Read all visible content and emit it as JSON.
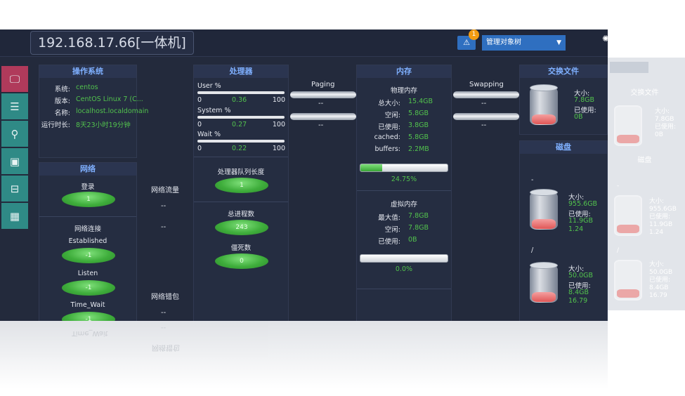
{
  "header": {
    "address": "192.168.17.66[一体机]",
    "alarm_count": "1",
    "alarm_icon": "⚠",
    "tree_select": "管理对象树"
  },
  "nav": [
    "monitor-icon",
    "list-icon",
    "network-icon",
    "storage-icon",
    "disk-icon",
    "table-icon"
  ],
  "os": {
    "title": "操作系统",
    "rows": [
      {
        "label": "系统:",
        "value": "centos"
      },
      {
        "label": "版本:",
        "value": "CentOS Linux 7 (C..."
      },
      {
        "label": "名称:",
        "value": "localhost.localdomain"
      },
      {
        "label": "运行时长:",
        "value": "8天23小时19分钟"
      }
    ]
  },
  "network": {
    "title": "网络",
    "login_label": "登录",
    "login_value": "1",
    "conn_title": "网络连接",
    "established_label": "Established",
    "established_value": "-1",
    "listen_label": "Listen",
    "listen_value": "-1",
    "timewait_label": "Time_Wait",
    "timewait_value": "-1"
  },
  "net_flow": {
    "title": "网络流量",
    "v1": "--",
    "v2": "--",
    "err_title": "网络错包",
    "err_v1": "--",
    "err_v2": "--"
  },
  "cpu": {
    "title": "处理器",
    "user_label": "User %",
    "user_min": "0",
    "user_val": "0.36",
    "user_max": "100",
    "system_label": "System %",
    "system_min": "0",
    "system_val": "0.27",
    "system_max": "100",
    "wait_label": "Wait %",
    "wait_min": "0",
    "wait_val": "0.22",
    "wait_max": "100",
    "queue_label": "处理器队列长度",
    "queue_value": "1",
    "proc_label": "总进程数",
    "proc_value": "243",
    "zombie_label": "僵死数",
    "zombie_value": "0"
  },
  "paging": {
    "label": "Paging",
    "v1": "--",
    "v2": "--"
  },
  "swapping": {
    "label": "Swapping",
    "v1": "--",
    "v2": "--"
  },
  "memory": {
    "title": "内存",
    "phys_title": "物理内存",
    "rows": [
      {
        "label": "总大小:",
        "value": "15.4GB"
      },
      {
        "label": "空闲:",
        "value": "5.8GB"
      },
      {
        "label": "已使用:",
        "value": "3.8GB"
      },
      {
        "label": "cached:",
        "value": "5.8GB"
      },
      {
        "label": "buffers:",
        "value": "2.2MB"
      }
    ],
    "phys_usage": 0.2475,
    "phys_usage_text": "24.75%",
    "virt_title": "虚拟内存",
    "virt_rows": [
      {
        "label": "最大值:",
        "value": "7.8GB"
      },
      {
        "label": "空闲:",
        "value": "7.8GB"
      },
      {
        "label": "已使用:",
        "value": "0B"
      }
    ],
    "virt_usage": 0.0,
    "virt_usage_text": "0.0%"
  },
  "swap_file": {
    "title": "交换文件",
    "size_label": "大小:",
    "size": "7.8GB",
    "used_label": "已使用:",
    "used": "0B"
  },
  "disk": {
    "title": "磁盘",
    "d1": {
      "name": "-",
      "size_label": "大小:",
      "size": "955.6GB",
      "used_label": "已使用:",
      "used": "11.9GB",
      "pct": "1.24"
    },
    "d2": {
      "name": "/",
      "size_label": "大小:",
      "size": "50.0GB",
      "used_label": "已使用:",
      "used": "8.4GB",
      "pct": "16.79"
    }
  },
  "ghost": {
    "swap_title": "交换文件",
    "swap_size_label": "大小:",
    "swap_size": "7.8GB",
    "swap_used_label": "已使用:",
    "swap_used": "0B",
    "disk_title": "磁盘",
    "d1_name": "-",
    "d1_size_label": "大小:",
    "d1_size": "955.6GB",
    "d1_used_label": "已使用:",
    "d1_used": "11.9GB",
    "d1_pct": "1.24",
    "d2_name": "/",
    "d2_size_label": "大小:",
    "d2_size": "50.0GB",
    "d2_used_label": "已使用:",
    "d2_used": "8.4GB",
    "d2_pct": "16.79"
  },
  "reflect": {
    "timewait": "Time_Wait",
    "err": "网络错包",
    "dash": "--"
  }
}
